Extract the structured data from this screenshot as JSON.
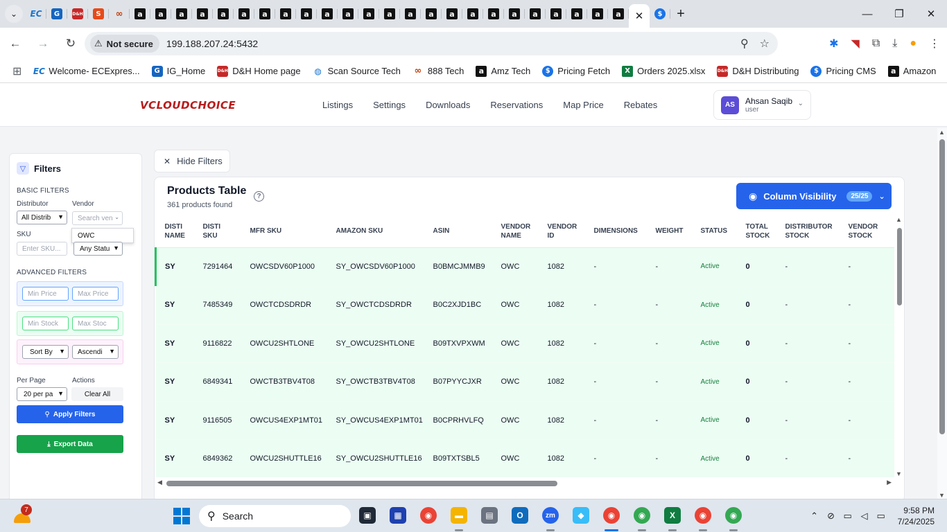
{
  "browser": {
    "tabs": [
      {
        "icon": "ec-icon",
        "glyph": "EC",
        "kind": "ec"
      },
      {
        "icon": "ig-icon",
        "glyph": "G",
        "kind": "ig"
      },
      {
        "icon": "dh-icon",
        "glyph": "D&H",
        "kind": "dh"
      },
      {
        "icon": "s-icon",
        "glyph": "S",
        "kind": "s8"
      },
      {
        "icon": "888-icon",
        "glyph": "∞",
        "kind": "knot"
      },
      {
        "icon": "amazon-tech-icon",
        "glyph": "a",
        "kind": "amz"
      },
      {
        "icon": "amazon-icon",
        "glyph": "a",
        "kind": "amz"
      },
      {
        "icon": "amazon-icon",
        "glyph": "a",
        "kind": "amz"
      },
      {
        "icon": "amazon-tech-icon",
        "glyph": "a",
        "kind": "amz"
      },
      {
        "icon": "amazon-icon",
        "glyph": "a",
        "kind": "amz"
      },
      {
        "icon": "amazon-icon",
        "glyph": "a",
        "kind": "amz"
      },
      {
        "icon": "amazon-icon",
        "glyph": "a",
        "kind": "amz"
      },
      {
        "icon": "amazon-icon",
        "glyph": "a",
        "kind": "amz"
      },
      {
        "icon": "amazon-icon",
        "glyph": "a",
        "kind": "amz"
      },
      {
        "icon": "amazon-icon",
        "glyph": "a",
        "kind": "amz"
      },
      {
        "icon": "amazon-icon",
        "glyph": "a",
        "kind": "amz"
      },
      {
        "icon": "amazon-icon",
        "glyph": "a",
        "kind": "amz"
      },
      {
        "icon": "amazon-icon",
        "glyph": "a",
        "kind": "amz"
      },
      {
        "icon": "amazon-icon",
        "glyph": "a",
        "kind": "amz"
      },
      {
        "icon": "amazon-icon",
        "glyph": "a",
        "kind": "amz"
      },
      {
        "icon": "amazon-icon",
        "glyph": "a",
        "kind": "amz"
      },
      {
        "icon": "amazon-icon",
        "glyph": "a",
        "kind": "amz"
      },
      {
        "icon": "amazon-icon",
        "glyph": "a",
        "kind": "amz"
      },
      {
        "icon": "amazon-icon",
        "glyph": "a",
        "kind": "amz"
      },
      {
        "icon": "amazon-icon",
        "glyph": "a",
        "kind": "amz"
      },
      {
        "icon": "amazon-icon",
        "glyph": "a",
        "kind": "amz"
      },
      {
        "icon": "amazon-icon",
        "glyph": "a",
        "kind": "amz"
      },
      {
        "icon": "amazon-icon",
        "glyph": "a",
        "kind": "amz"
      },
      {
        "icon": "amazon-icon",
        "glyph": "a",
        "kind": "amz"
      }
    ],
    "after_tab": {
      "icon": "pricing-icon",
      "glyph": "$",
      "kind": "pf"
    },
    "security_label": "Not secure",
    "url": "199.188.207.24:5432",
    "bookmarks": [
      {
        "icon": "ec-icon",
        "glyph": "EC",
        "kind": "ec",
        "label": "Welcome- ECExpres..."
      },
      {
        "icon": "ig-icon",
        "glyph": "G",
        "kind": "ig",
        "label": "IG_Home"
      },
      {
        "icon": "dh-icon",
        "glyph": "D&H",
        "kind": "dh",
        "label": "D&H Home page"
      },
      {
        "icon": "globe-icon",
        "glyph": "◍",
        "kind": "ec",
        "label": "Scan Source Tech"
      },
      {
        "icon": "888-icon",
        "glyph": "∞",
        "kind": "knot",
        "label": "888 Tech"
      },
      {
        "icon": "amazon-tech-icon",
        "glyph": "a",
        "kind": "amz",
        "label": "Amz Tech"
      },
      {
        "icon": "pricing-icon",
        "glyph": "$",
        "kind": "pf",
        "label": "Pricing Fetch"
      },
      {
        "icon": "excel-icon",
        "glyph": "X",
        "kind": "xl",
        "label": "Orders 2025.xlsx"
      },
      {
        "icon": "dh-icon",
        "glyph": "D&H",
        "kind": "dh",
        "label": "D&H Distributing"
      },
      {
        "icon": "pricing-icon",
        "glyph": "$",
        "kind": "pf",
        "label": "Pricing CMS"
      },
      {
        "icon": "amazon-icon",
        "glyph": "a",
        "kind": "amz",
        "label": "Amazon"
      }
    ]
  },
  "app": {
    "logo": "VCLOUDCHOICE",
    "nav": [
      "Listings",
      "Settings",
      "Downloads",
      "Reservations",
      "Map Price",
      "Rebates"
    ],
    "user": {
      "initials": "AS",
      "name": "Ahsan Saqib",
      "role": "user"
    },
    "hide_filters": "Hide Filters",
    "filters": {
      "title": "Filters",
      "basic_title": "BASIC FILTERS",
      "distributor_label": "Distributor",
      "distributor_value": "All Distrib",
      "vendor_label": "Vendor",
      "vendor_placeholder": "Search ven",
      "vendor_suggestion": "OWC",
      "sku_label": "SKU",
      "sku_placeholder": "Enter SKU...",
      "status_value": "Any Statu",
      "advanced_title": "ADVANCED FILTERS",
      "min_price": "Min Price",
      "max_price": "Max Price",
      "min_stock": "Min Stock",
      "max_stock": "Max Stoc",
      "sort_by": "Sort By",
      "sort_order": "Ascendi",
      "per_page_label": "Per Page",
      "per_page_value": "20 per pa",
      "actions_label": "Actions",
      "clear_all": "Clear All",
      "apply": "Apply Filters",
      "export": "Export Data"
    },
    "table": {
      "title": "Products Table",
      "count": "361 products found",
      "column_visibility": "Column Visibility",
      "column_badge": "25/25",
      "columns": [
        [
          "DISTI",
          "NAME"
        ],
        [
          "DISTI",
          "SKU"
        ],
        [
          "MFR SKU",
          ""
        ],
        [
          "AMAZON SKU",
          ""
        ],
        [
          "ASIN",
          ""
        ],
        [
          "VENDOR",
          "NAME"
        ],
        [
          "VENDOR",
          "ID"
        ],
        [
          "DIMENSIONS",
          ""
        ],
        [
          "WEIGHT",
          ""
        ],
        [
          "STATUS",
          ""
        ],
        [
          "TOTAL",
          "STOCK"
        ],
        [
          "DISTRIBUTOR",
          "STOCK"
        ],
        [
          "VENDOR",
          "STOCK"
        ]
      ],
      "rows": [
        [
          "SY",
          "7291464",
          "OWCSDV60P1000",
          "SY_OWCSDV60P1000",
          "B0BMCJMMB9",
          "OWC",
          "1082",
          "-",
          "-",
          "Active",
          "0",
          "-",
          "-"
        ],
        [
          "SY",
          "7485349",
          "OWCTCDSDRDR",
          "SY_OWCTCDSDRDR",
          "B0C2XJD1BC",
          "OWC",
          "1082",
          "-",
          "-",
          "Active",
          "0",
          "-",
          "-"
        ],
        [
          "SY",
          "9116822",
          "OWCU2SHTLONE",
          "SY_OWCU2SHTLONE",
          "B09TXVPXWM",
          "OWC",
          "1082",
          "-",
          "-",
          "Active",
          "0",
          "-",
          "-"
        ],
        [
          "SY",
          "6849341",
          "OWCTB3TBV4T08",
          "SY_OWCTB3TBV4T08",
          "B07PYYCJXR",
          "OWC",
          "1082",
          "-",
          "-",
          "Active",
          "0",
          "-",
          "-"
        ],
        [
          "SY",
          "9116505",
          "OWCUS4EXP1MT01",
          "SY_OWCUS4EXP1MT01",
          "B0CPRHVLFQ",
          "OWC",
          "1082",
          "-",
          "-",
          "Active",
          "0",
          "-",
          "-"
        ],
        [
          "SY",
          "6849362",
          "OWCU2SHUTTLE16",
          "SY_OWCU2SHUTTLE16",
          "B09TXTSBL5",
          "OWC",
          "1082",
          "-",
          "-",
          "Active",
          "0",
          "-",
          "-"
        ]
      ]
    }
  },
  "taskbar": {
    "weather_badge": "7",
    "search_placeholder": "Search",
    "time": "9:58 PM",
    "date": "7/24/2025"
  }
}
